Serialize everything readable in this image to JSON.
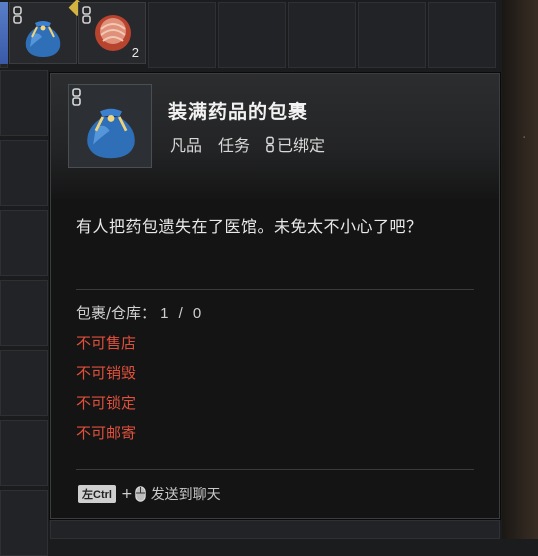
{
  "inventory": {
    "slots": [
      {
        "icon": "medicine-bag-icon",
        "bound": true
      },
      {
        "icon": "red-bundle-icon",
        "bound": true,
        "count": "2"
      }
    ]
  },
  "tooltip": {
    "item_name": "装满药品的包裹",
    "quality": "凡品",
    "category": "任务",
    "bound_label": "已绑定",
    "description": "有人把药包遗失在了医馆。未免太不小心了吧？",
    "stock_label": "包裹/仓库：",
    "stock_value": "1 / 0",
    "restrictions": [
      "不可售店",
      "不可销毁",
      "不可锁定",
      "不可邮寄"
    ],
    "footer": {
      "key_label": "左Ctrl",
      "plus": "+",
      "action_label": "发送到聊天"
    }
  },
  "colors": {
    "restriction_text": "#e0503a",
    "tooltip_bg": "#141415",
    "bag_blue": "#2f6fb8"
  }
}
